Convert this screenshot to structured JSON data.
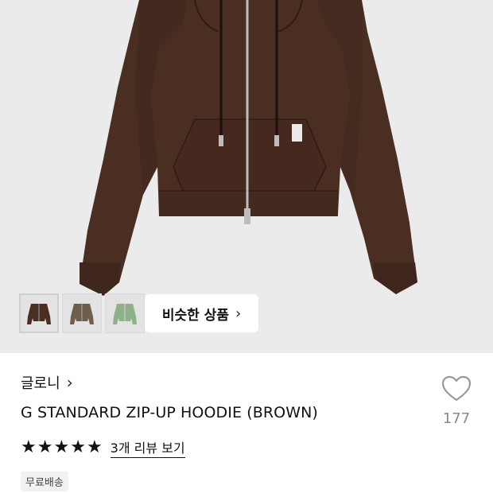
{
  "product": {
    "thumbnails": [
      {
        "name": "brown",
        "color": "#4a2e22"
      },
      {
        "name": "taupe",
        "color": "#6f5d4e"
      },
      {
        "name": "sage",
        "color": "#8fb089"
      }
    ],
    "similar_button_label": "비슷한 상품",
    "brand": "글로니",
    "title": "G STANDARD ZIP-UP HOODIE (BROWN)",
    "rating": 5,
    "review_link": "3개 리뷰 보기",
    "badge": "무료배송",
    "like_count": "177",
    "colors": {
      "hero_bg": "#ebebeb",
      "hoodie": "#4a2e22"
    }
  }
}
